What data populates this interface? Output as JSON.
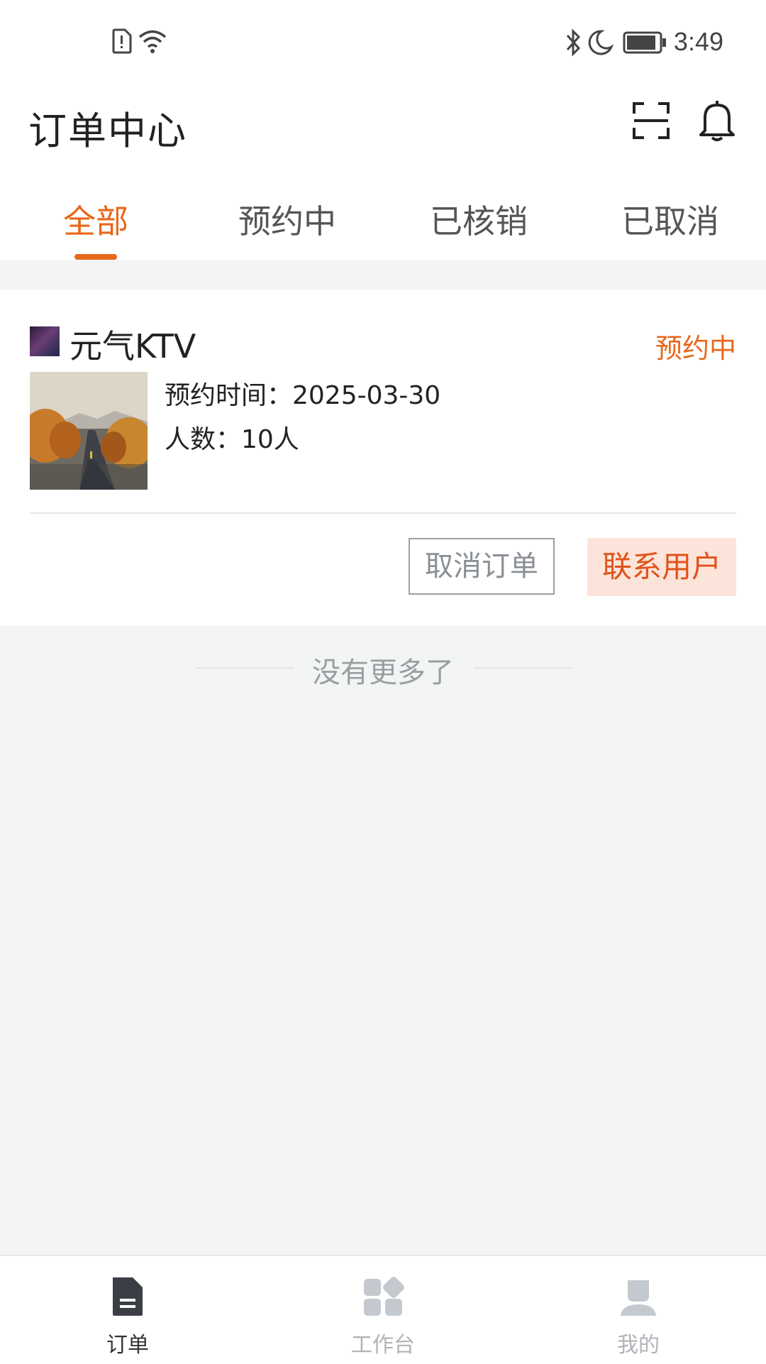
{
  "status_bar": {
    "time": "3:49"
  },
  "header": {
    "title": "订单中心"
  },
  "tabs": [
    {
      "label": "全部",
      "active": true
    },
    {
      "label": "预约中",
      "active": false
    },
    {
      "label": "已核销",
      "active": false
    },
    {
      "label": "已取消",
      "active": false
    }
  ],
  "order": {
    "store_name": "元气KTV",
    "status": "预约中",
    "reservation_time": "预约时间：2025-03-30",
    "people": "人数：10人",
    "cancel_label": "取消订单",
    "contact_label": "联系用户"
  },
  "list_end_text": "没有更多了",
  "bottom_nav": [
    {
      "label": "订单",
      "icon": "document-icon",
      "active": true
    },
    {
      "label": "工作台",
      "icon": "workbench-icon",
      "active": false
    },
    {
      "label": "我的",
      "icon": "profile-icon",
      "active": false
    }
  ],
  "colors": {
    "accent": "#e8671a",
    "contact_bg": "#fde4da",
    "page_bg": "#f3f4f4"
  }
}
